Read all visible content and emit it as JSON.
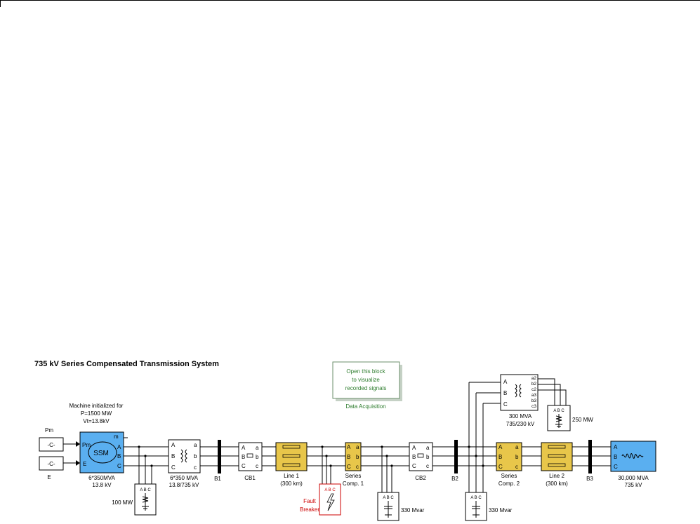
{
  "title": "735 kV Series Compensated Transmission System",
  "data_acquisition": {
    "body": [
      "Open this block",
      "to visualize",
      "recorded signals"
    ],
    "label": "Data Acquisition"
  },
  "machine_note": [
    "Machine initialized for",
    "P=1500 MW",
    "Vt=13.8kV"
  ],
  "sources": {
    "pm_label": "Pm",
    "pm_value": "-C-",
    "e_label": "E",
    "e_value": "-C-"
  },
  "machine": {
    "name": "SSM",
    "port_pm": "Pm",
    "port_e": "E",
    "port_m": "m",
    "ports_abc": [
      "A",
      "B",
      "C"
    ],
    "label": [
      "6*350MVA",
      "13.8 kV"
    ]
  },
  "load_100": {
    "label": "100 MW",
    "abc": "A B C"
  },
  "transformer1": {
    "label": [
      "6*350 MVA",
      "13.8/735 kV"
    ],
    "left": [
      "A",
      "B",
      "C"
    ],
    "right": [
      "a",
      "b",
      "c"
    ]
  },
  "bus_b1": "B1",
  "cb1": {
    "label": "CB1",
    "letters": [
      "A",
      "a",
      "B",
      "b",
      "C",
      "c"
    ]
  },
  "line1": {
    "label": [
      "Line 1",
      "(300 km)"
    ]
  },
  "fault": {
    "label": [
      "Fault",
      "Breaker"
    ],
    "abc": "A B C"
  },
  "series_comp1": {
    "label": [
      "Series",
      "Comp. 1"
    ],
    "letters": [
      "A",
      "a",
      "B",
      "b",
      "C",
      "c"
    ]
  },
  "shunt_330_1": {
    "label": "330 Mvar",
    "abc": "A B C"
  },
  "cb2": {
    "label": "CB2",
    "letters": [
      "A",
      "a",
      "B",
      "b",
      "C",
      "c"
    ]
  },
  "bus_b2": "B2",
  "shunt_330_2": {
    "label": "330 Mvar",
    "abc": "A B C"
  },
  "transformer2": {
    "label": [
      "300 MVA",
      "735/230 kV"
    ],
    "left": [
      "A",
      "B",
      "C"
    ],
    "right": [
      "a2",
      "b2",
      "c2",
      "a3",
      "b3",
      "c3"
    ]
  },
  "load_250": {
    "label": "250 MW",
    "abc": "A B C"
  },
  "series_comp2": {
    "label": [
      "Series",
      "Comp. 2"
    ],
    "letters": [
      "A",
      "a",
      "B",
      "b",
      "C",
      "c"
    ]
  },
  "line2": {
    "label": [
      "Line 2",
      "(300 km)"
    ]
  },
  "bus_b3": "B3",
  "equivalent": {
    "label": [
      "30,000 MVA",
      "735 kV"
    ],
    "abc": [
      "A",
      "B",
      "C"
    ]
  },
  "colors": {
    "machine_fill": "#5aaff0",
    "source_fill": "#5aaff0",
    "comp_fill": "#e8c64a",
    "line_fill": "#e8c64a",
    "data_acq": "#2e7d2e",
    "fault": "#cc0000"
  }
}
